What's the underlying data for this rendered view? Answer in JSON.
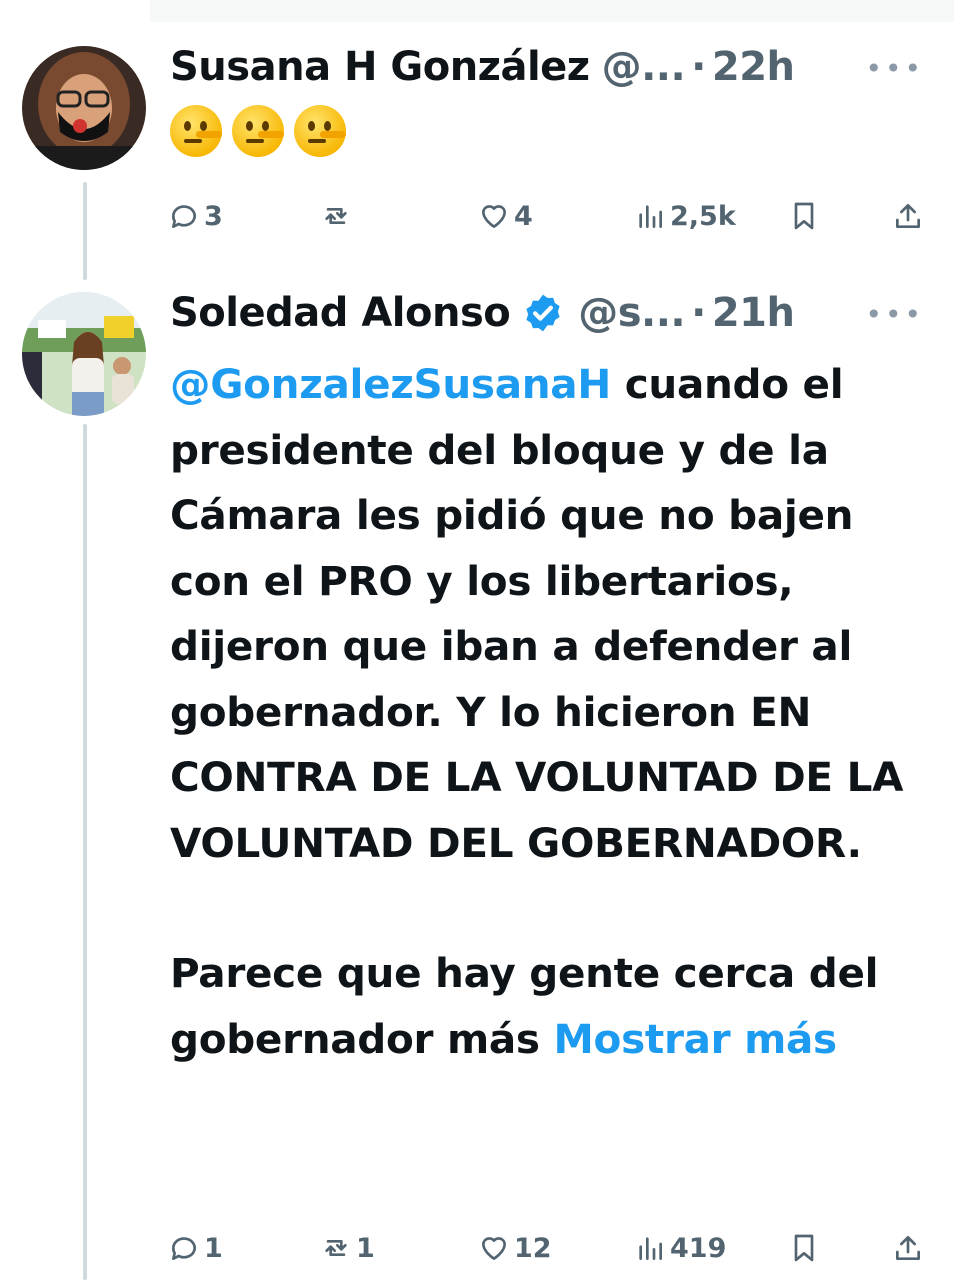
{
  "tweets": [
    {
      "name": "Susana H González",
      "handle": "@...",
      "time": "22h",
      "verified": false,
      "emoji": [
        "lying-face",
        "lying-face",
        "lying-face"
      ],
      "actions": {
        "replies": "3",
        "retweets": "",
        "likes": "4",
        "views": "2,5k"
      }
    },
    {
      "name": "Soledad Alonso",
      "handle": "@s...",
      "time": "21h",
      "verified": true,
      "mention": "@GonzalezSusanaH",
      "text_part1": " cuando el presidente del bloque y de la Cámara les pidió que no bajen con el PRO y los libertarios, dijeron que iban a defender al gobernador. Y lo hicieron EN CONTRA DE LA VOLUNTAD DE LA VOLUNTAD DEL GOBERNADOR.",
      "text_part2": "Parece que hay gente cerca del gobernador más",
      "show_more": "Mostrar más",
      "actions": {
        "replies": "1",
        "retweets": "1",
        "likes": "12",
        "views": "419"
      }
    }
  ],
  "separator": "·",
  "more_icon": "•••",
  "colors": {
    "link": "#1d9bf0",
    "muted": "#536471",
    "text": "#0f1419",
    "verified": "#1d9bf0"
  }
}
